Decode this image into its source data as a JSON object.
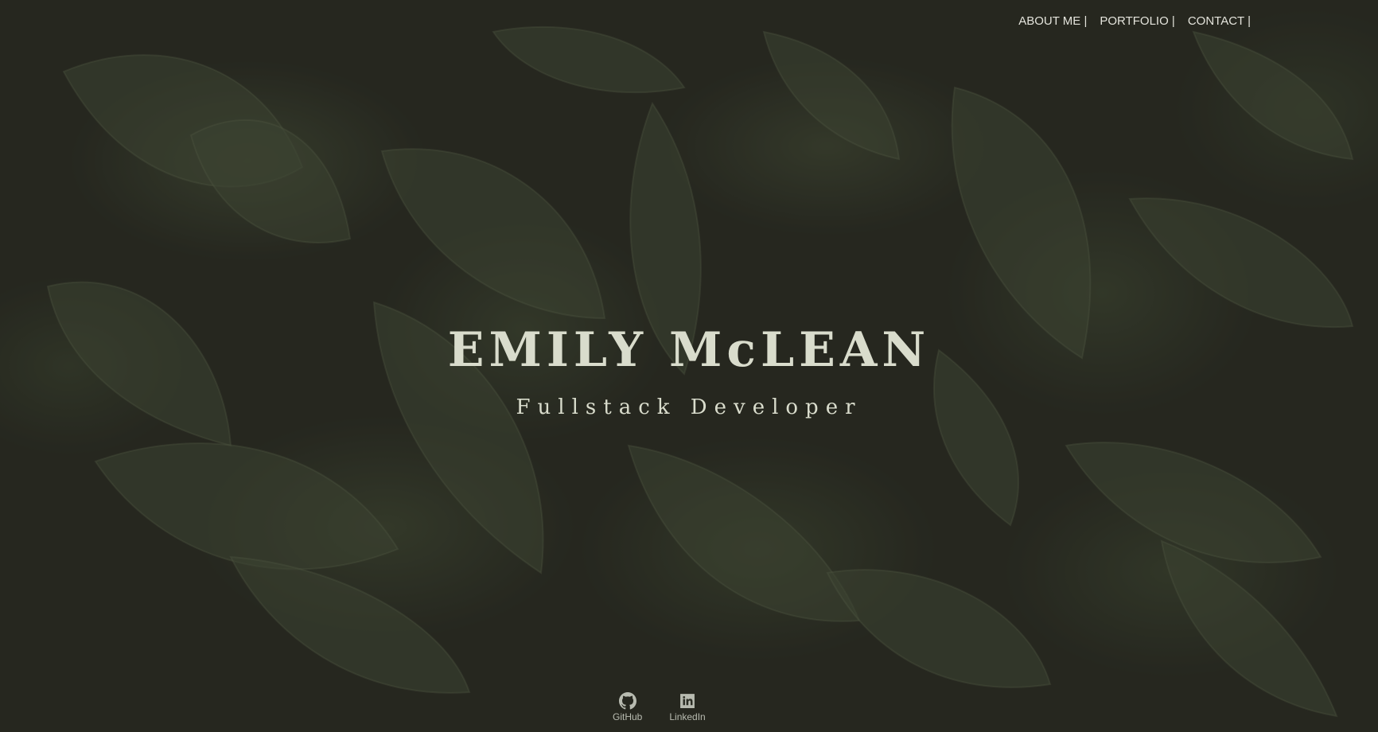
{
  "nav": {
    "items": [
      {
        "label": "ABOUT ME |"
      },
      {
        "label": "PORTFOLIO |"
      },
      {
        "label": "CONTACT |"
      }
    ]
  },
  "hero": {
    "name": "EMILY McLEAN",
    "role": "Fullstack Developer"
  },
  "social": {
    "github_label": "GitHub",
    "github_icon": "github-icon",
    "linkedin_label": "LinkedIn",
    "linkedin_icon": "linkedin-icon"
  },
  "colors": {
    "background": "#2b2d24",
    "leaf": "#56624a",
    "title_text": "#d9dccc",
    "nav_text": "#e4e4dc"
  }
}
